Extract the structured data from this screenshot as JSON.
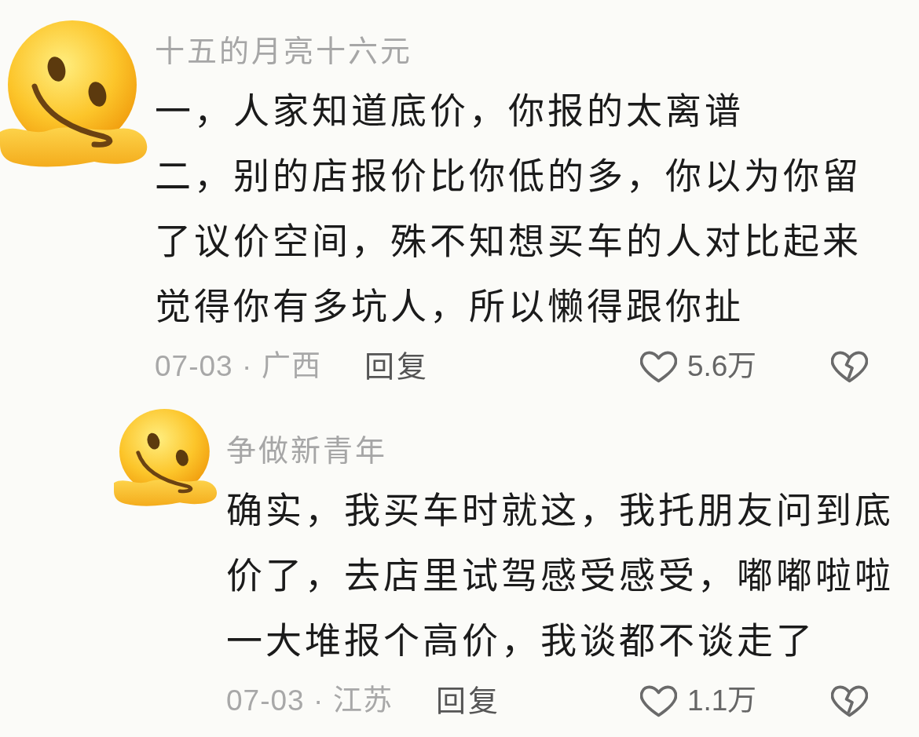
{
  "comments": [
    {
      "username": "十五的月亮十六元",
      "paragraphs": [
        "一，人家知道底价，你报的太离谱",
        "二，别的店报价比你低的多，你以为你留了议价空间，殊不知想买车的人对比起来觉得你有多坑人，所以懒得跟你扯"
      ],
      "info": "07-03 · 广西",
      "reply_label": "回复",
      "likes": "5.6万",
      "children": [
        {
          "username": "争做新青年",
          "paragraphs": [
            "确实，我买车时就这，我托朋友问到底价了，去店里试驾感受感受，嘟嘟啦啦一大堆报个高价，我谈都不谈走了"
          ],
          "info": "07-03 · 江苏",
          "reply_label": "回复",
          "likes": "1.1万"
        }
      ]
    }
  ]
}
